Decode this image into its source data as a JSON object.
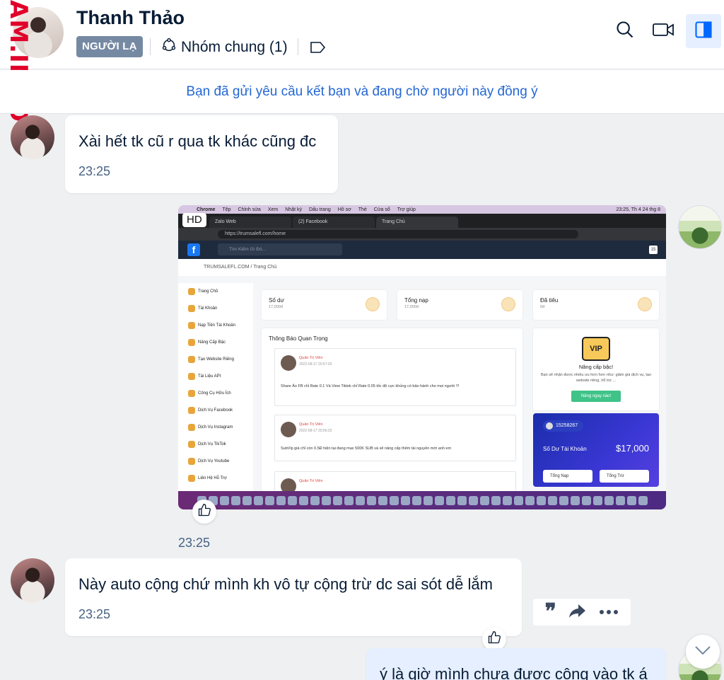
{
  "header": {
    "watermark": "AM.INFO",
    "contact_name": "Thanh Thảo",
    "stranger_badge": "NGƯỜI LẠ",
    "group_link": "Nhóm chung (1)"
  },
  "banner": {
    "text": "Bạn đã gửi yêu cầu kết bạn và đang chờ người này đồng ý"
  },
  "messages": [
    {
      "text": "Xài hết tk cũ r qua tk khác cũng đc",
      "time": "23:25"
    },
    {
      "image_badge": "HD",
      "time": "23:25"
    },
    {
      "text": "Này auto cộng chứ mình kh vô tự cộng trừ dc sai sót dễ lắm",
      "time": "23:25"
    },
    {
      "text": "ý là giờ mình chưa được cộng vào tk á"
    }
  ],
  "screenshot": {
    "menubar": [
      "Chrome",
      "Tệp",
      "Chỉnh sửa",
      "Xem",
      "Nhật ký",
      "Dấu trang",
      "Hồ sơ",
      "Thẻ",
      "Cửa sổ",
      "Trợ giúp"
    ],
    "clock": "23:25, Th 4 24 thg 8",
    "tabs": [
      "Zalo Web",
      "(2) Facebook",
      "Trang Chủ"
    ],
    "url": "https://trumsalefl.com/home",
    "search_placeholder": "Tìm Kiếm Gì Đó...",
    "breadcrumb": "TRUMSALEFL.COM / Trang Chủ",
    "sidebar": [
      "Trang Chủ",
      "Tài Khoản",
      "Nạp Tiền Tài Khoản",
      "Nâng Cấp Bậc",
      "Tạo Website Riêng",
      "Tài Liệu API",
      "Công Cụ Hữu Ích",
      "Dịch Vụ Facebook",
      "Dịch Vụ Instagram",
      "Dịch Vụ TikTok",
      "Dịch Vụ Youtube",
      "Liên Hệ Hỗ Trợ"
    ],
    "stats": [
      {
        "title": "Số dư",
        "sub": "17,000đ"
      },
      {
        "title": "Tổng nạp",
        "sub": "17,000đ"
      },
      {
        "title": "Đã tiêu",
        "sub": "0đ"
      }
    ],
    "notice_title": "Thông Báo Quan Trọng",
    "posts": [
      {
        "author": "Quản Trị Viên",
        "date": "2022-08-17 20:57:20",
        "text": "Share Ảo FB chỉ Rate 0.1 Và View Tiktok chỉ Rate 0.05 tốc độ cực khủng có bảo hành cho mọi người !!!"
      },
      {
        "author": "Quản Trị Viên",
        "date": "2022-08-17 20:56:23",
        "text": "SubVip giá chỉ còn 0.5Đ hiện tại đang max 500K SUB và sẽ nâng cấp thêm tài nguyên mời anh em"
      },
      {
        "author": "Quản Trị Viên"
      }
    ],
    "vip": {
      "icon_text": "VIP",
      "title": "Nâng cấp bậc!",
      "desc": "Bạn sẽ nhận được nhiều ưu hơn hơn như: giảm giá dịch vụ, tạo website riêng, hỗ trợ ...",
      "button": "Nâng ngay nào!"
    },
    "balance": {
      "id": "15258267",
      "label": "Số Dư Tài Khoản",
      "amount": "$17,000",
      "btn_in": "Tổng Nạp",
      "btn_out": "Tổng Trừ"
    },
    "notif_count": "15"
  },
  "colors": {
    "accent": "#2467d4",
    "bubble_mine": "#e5efff",
    "badge": "#7589a3",
    "watermark": "#e0002a"
  }
}
